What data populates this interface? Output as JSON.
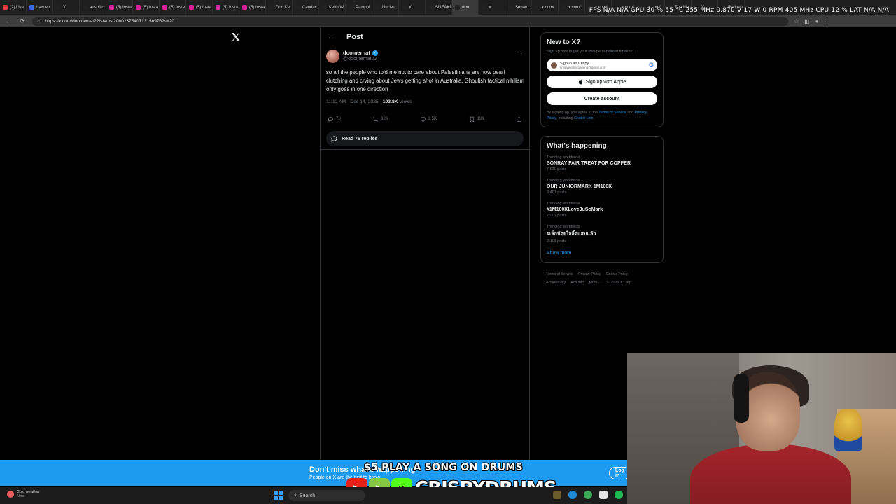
{
  "browser": {
    "tabs": [
      {
        "label": "(2) Live",
        "color": "#e03a3a"
      },
      {
        "label": "Law en",
        "color": "#3b6fd8"
      },
      {
        "label": "X",
        "color": "#222222"
      },
      {
        "label": "auspil c",
        "color": "#222222"
      },
      {
        "label": "(5) Insta",
        "color": "#d6249f"
      },
      {
        "label": "(5) Insta",
        "color": "#d6249f"
      },
      {
        "label": "(5) Insta",
        "color": "#d6249f"
      },
      {
        "label": "(5) Insta",
        "color": "#d6249f"
      },
      {
        "label": "(5) Insta",
        "color": "#d6249f"
      },
      {
        "label": "(5) Insta",
        "color": "#d6249f"
      },
      {
        "label": "Don Ke",
        "color": "#222222"
      },
      {
        "label": "Candac",
        "color": "#222222"
      },
      {
        "label": "Keith W",
        "color": "#222222"
      },
      {
        "label": "Pamphl",
        "color": "#222222"
      },
      {
        "label": "Nucleu",
        "color": "#222222"
      },
      {
        "label": "X",
        "color": "#222222"
      },
      {
        "label": "SNEAKI",
        "color": "#222222"
      },
      {
        "label": "doo",
        "color": "#222222"
      },
      {
        "label": "X",
        "color": "#222222"
      },
      {
        "label": "Senato",
        "color": "#222222"
      },
      {
        "label": "x.com/",
        "color": "#222222"
      },
      {
        "label": "x.com/",
        "color": "#222222"
      },
      {
        "label": "x.com/",
        "color": "#222222"
      },
      {
        "label": "x.com/",
        "color": "#222222"
      },
      {
        "label": "x.com/",
        "color": "#222222"
      },
      {
        "label": "The Ma",
        "color": "#222222"
      },
      {
        "label": "X",
        "color": "#222222"
      },
      {
        "label": "Redneb",
        "color": "#222222"
      }
    ],
    "active_tab_index": 17,
    "url": "https://x.com/doomernat22/status/2000237540713156976?s=20",
    "stats_overlay": "FPS  N/A  N/A     GPU 30 %  55 °C  255 MHz  0.870 V  17 W  0 RPM  405 MHz     CPU  12 %     LAT  N/A  N/A"
  },
  "header": {
    "back_label": "←",
    "title": "Post"
  },
  "tweet": {
    "display_name": "doomernat",
    "handle": "@doomernat22",
    "text": "so all the people who told me not to care about Palestinians are now pearl clutching and crying about Jews getting shot in Australia. Ghoulish tactical nihilism only goes in one direction",
    "time": "11:12 AM · Dec 14, 2025 · ",
    "views_count": "103.8K",
    "views_label": " Views",
    "replies": "76",
    "reposts": "326",
    "likes": "2.5K",
    "bookmarks": "138",
    "read_replies": "Read 76 replies"
  },
  "sidebar": {
    "new_to_x": {
      "title": "New to X?",
      "subtitle": "Sign up now to get your own personalized timeline!",
      "google_line1": "Sign in as Crispy",
      "google_line2": "crispymostergaming@gmail.com",
      "apple_label": "Sign up with Apple",
      "create_label": "Create account",
      "terms_pre": "By signing up, you agree to the ",
      "terms_link": "Terms of Service",
      "terms_and": " and ",
      "privacy_link": "Privacy Policy",
      "terms_mid": ", including ",
      "cookie_link": "Cookie Use."
    },
    "whats_happening": {
      "title": "What's happening",
      "trends": [
        {
          "context": "Trending worldwide",
          "name": "SONRAY FAIR TREAT FOR COPPER",
          "posts": "7,620 posts"
        },
        {
          "context": "Trending worldwide",
          "name": "OUR JUNIORMARK 1M100K",
          "posts": "3,401 posts"
        },
        {
          "context": "Trending worldwide",
          "name": "#1M100KLoveJuSoMark",
          "posts": "2,007 posts"
        },
        {
          "context": "Trending worldwide",
          "name": "#เล็กน้อยใจจี๊ดแสนแล้ว",
          "posts": "2,113 posts"
        }
      ],
      "show_more": "Show more"
    },
    "footer": [
      "Terms of Service",
      "Privacy Policy",
      "Cookie Policy",
      "Accessibility",
      "Ads info",
      "More ···",
      "© 2025 X Corp."
    ]
  },
  "login_banner": {
    "title": "Don't miss what's happening",
    "subtitle": "People on X are the first to know.",
    "login": "Log in"
  },
  "stream_overlay": {
    "promo_top": "$5 PLAY A SONG ON DRUMS",
    "promo_name": "CRISPYDRUMS"
  },
  "taskbar": {
    "weather_title": "Cold weather",
    "weather_sub": "Now",
    "search": "Search"
  }
}
